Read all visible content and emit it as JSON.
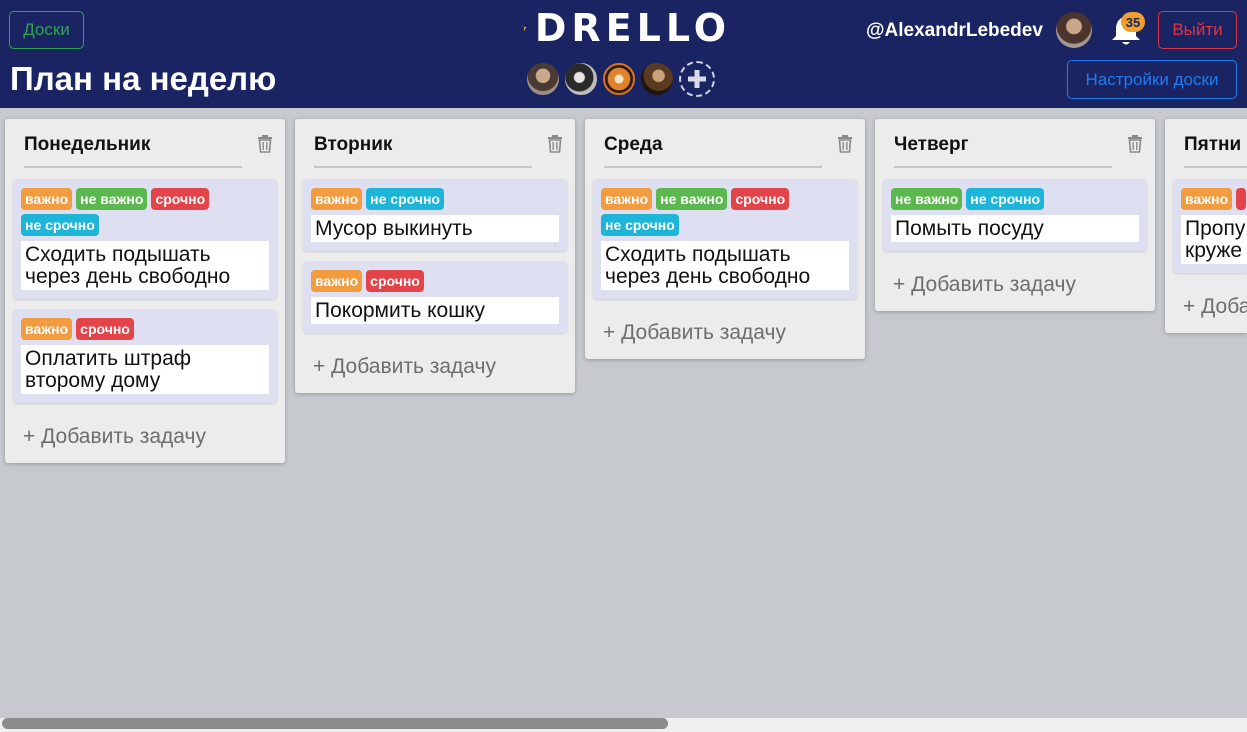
{
  "header": {
    "boards_label": "Доски",
    "board_title": "План на неделю",
    "logo_text": "DRELLO",
    "username": "@AlexandrLebedev",
    "notifications_count": "35",
    "logout_label": "Выйти",
    "settings_label": "Настройки доски",
    "add_member_icon": "plus-icon"
  },
  "colors": {
    "header_bg": "#1b2463",
    "board_bg": "#c6cace",
    "tag_vazhno": "#f29b3f",
    "tag_ne_vazhno": "#5ab84e",
    "tag_srochno": "#e2444a",
    "tag_ne_srochno": "#1eb6d8"
  },
  "columns": [
    {
      "title": "Понедельник",
      "cards": [
        {
          "tags": [
            "важно",
            "не важно",
            "срочно",
            "не срочно"
          ],
          "text": "Сходить подышать через день свободно"
        },
        {
          "tags": [
            "важно",
            "срочно"
          ],
          "text": "Оплатить штраф второму дому"
        }
      ],
      "add_label": "+ Добавить задачу"
    },
    {
      "title": "Вторник",
      "cards": [
        {
          "tags": [
            "важно",
            "не срочно"
          ],
          "text": "Мусор выкинуть"
        },
        {
          "tags": [
            "важно",
            "срочно"
          ],
          "text": "Покормить кошку"
        }
      ],
      "add_label": "+ Добавить задачу"
    },
    {
      "title": "Среда",
      "cards": [
        {
          "tags": [
            "важно",
            "не важно",
            "срочно",
            "не срочно"
          ],
          "text": "Сходить подышать через день свободно"
        }
      ],
      "add_label": "+ Добавить задачу"
    },
    {
      "title": "Четверг",
      "cards": [
        {
          "tags": [
            "не важно",
            "не срочно"
          ],
          "text": "Помыть посуду"
        }
      ],
      "add_label": "+ Добавить задачу"
    },
    {
      "title": "Пятни",
      "cards": [
        {
          "tags": [
            "важно",
            ""
          ],
          "text": "Пропу круже"
        }
      ],
      "add_label": "+ Доба"
    }
  ]
}
